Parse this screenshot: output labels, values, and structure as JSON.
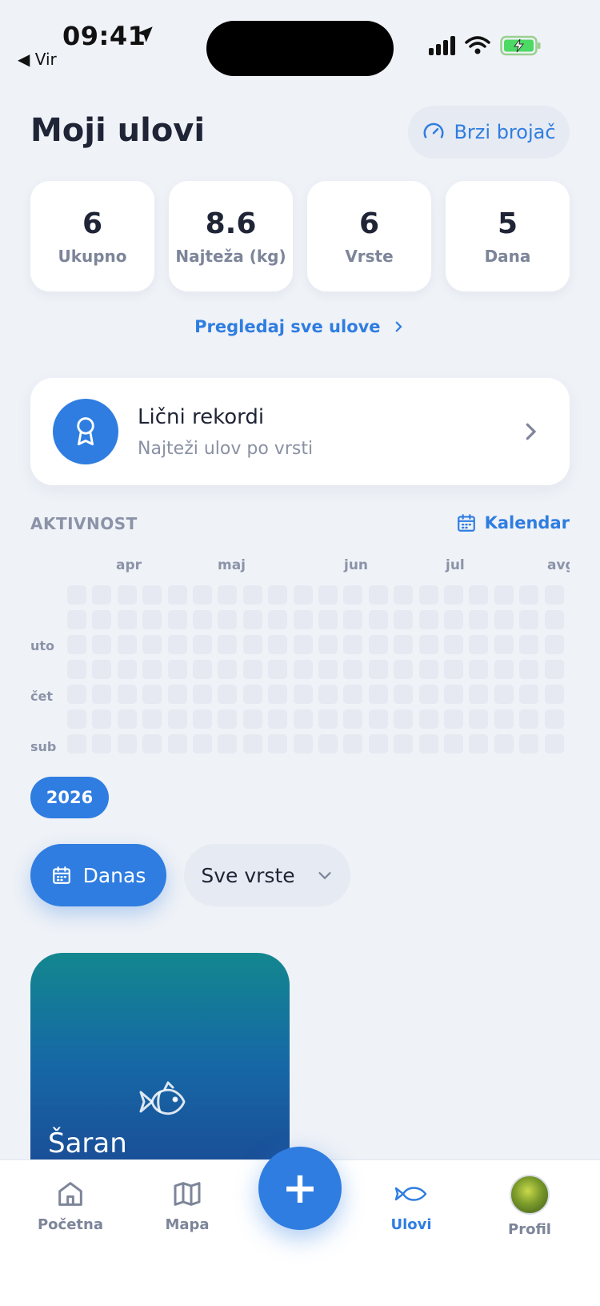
{
  "status_bar": {
    "time": "09:41",
    "back_app": "◀ Vir"
  },
  "header": {
    "title": "Moji ulovi",
    "quick_counter_label": "Brzi brojač"
  },
  "stats": [
    {
      "value": "6",
      "label": "Ukupno"
    },
    {
      "value": "8.6",
      "label": "Najteža (kg)"
    },
    {
      "value": "6",
      "label": "Vrste"
    },
    {
      "value": "5",
      "label": "Dana"
    }
  ],
  "view_all_label": "Pregledaj sve ulove",
  "records": {
    "title": "Lični rekordi",
    "subtitle": "Najteži ulov po vrsti"
  },
  "activity": {
    "section_label": "AKTIVNOST",
    "calendar_label": "Kalendar",
    "months": [
      "apr",
      "maj",
      "jun",
      "jul",
      "avg"
    ],
    "day_labels": [
      "uto",
      "čet",
      "sub"
    ],
    "year": "2026"
  },
  "filters": {
    "today_label": "Danas",
    "species_select_value": "Sve vrste"
  },
  "catches": [
    {
      "species": "Šaran"
    }
  ],
  "nav": {
    "home": "Početna",
    "map": "Mapa",
    "catches": "Ulovi",
    "profile": "Profil",
    "fab": "+"
  },
  "colors": {
    "accent": "#2f7de1",
    "background": "#eff2f7",
    "text_primary": "#1f2536",
    "text_muted": "#8b93a8"
  },
  "icons": {
    "quick_counter": "gauge-icon",
    "records": "award-ribbon-icon",
    "calendar": "calendar-icon",
    "home": "home-icon",
    "map": "map-icon",
    "catches": "fish-icon"
  }
}
